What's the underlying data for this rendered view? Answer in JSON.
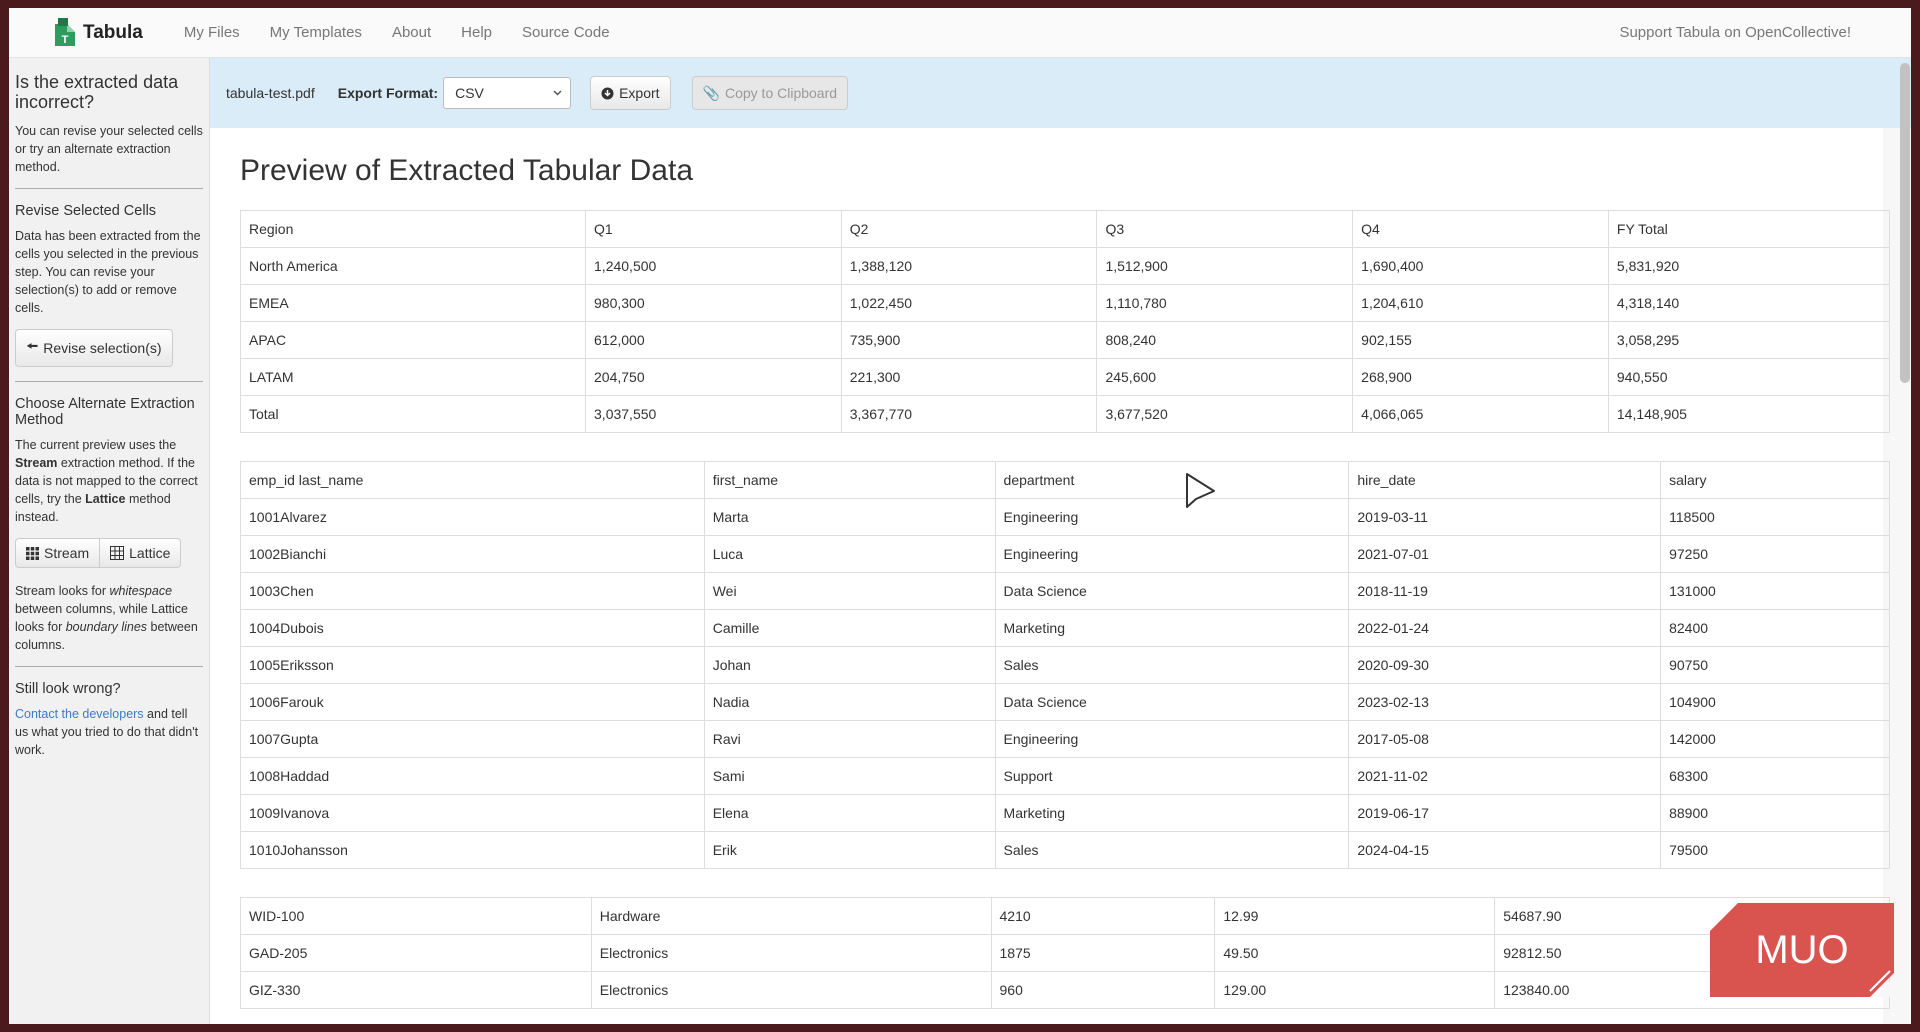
{
  "nav": {
    "brand": "Tabula",
    "links": [
      "My Files",
      "My Templates",
      "About",
      "Help",
      "Source Code"
    ],
    "support": "Support Tabula on OpenCollective!"
  },
  "sidebar": {
    "title": "Is the extracted data incorrect?",
    "intro": "You can revise your selected cells or try an alternate extraction method.",
    "revise_heading": "Revise Selected Cells",
    "revise_text": "Data has been extracted from the cells you selected in the previous step. You can revise your selection(s) to add or remove cells.",
    "revise_button": "Revise selection(s)",
    "method_heading": "Choose Alternate Extraction Method",
    "method_text_1": "The current preview uses the",
    "method_stream_bold": "Stream",
    "method_text_2": "extraction method. If the data is not mapped to the correct cells, try the",
    "method_lattice_bold": "Lattice",
    "method_text_3": "method instead.",
    "stream_button": "Stream",
    "lattice_button": "Lattice",
    "explain_1": "Stream looks for",
    "explain_whitespace": "whitespace",
    "explain_2": "between columns, while Lattice looks for",
    "explain_boundary": "boundary lines",
    "explain_3": "between columns.",
    "wrong_heading": "Still look wrong?",
    "contact_link": "Contact the developers",
    "contact_text": "and tell us what you tried to do that didn't work."
  },
  "toolbar": {
    "filename": "tabula-test.pdf",
    "format_label": "Export Format:",
    "format_value": "CSV",
    "export_button": "Export",
    "copy_button": "Copy to Clipboard"
  },
  "main": {
    "title": "Preview of Extracted Tabular Data",
    "tables": [
      {
        "col_widths": [
          340,
          252,
          252,
          252,
          252,
          277
        ],
        "rows": [
          [
            "Region",
            "Q1",
            "Q2",
            "Q3",
            "Q4",
            "FY Total"
          ],
          [
            "North America",
            "1,240,500",
            "1,388,120",
            "1,512,900",
            "1,690,400",
            "5,831,920"
          ],
          [
            "EMEA",
            "980,300",
            "1,022,450",
            "1,110,780",
            "1,204,610",
            "4,318,140"
          ],
          [
            "APAC",
            "612,000",
            "735,900",
            "808,240",
            "902,155",
            "3,058,295"
          ],
          [
            "LATAM",
            "204,750",
            "221,300",
            "245,600",
            "268,900",
            "940,550"
          ],
          [
            "Total",
            "3,037,550",
            "3,367,770",
            "3,677,520",
            "4,066,065",
            "14,148,905"
          ]
        ]
      },
      {
        "col_widths": [
          464,
          291,
          354,
          312,
          229
        ],
        "rows": [
          [
            "emp_id last_name",
            "first_name",
            "department",
            "hire_date",
            "salary"
          ],
          [
            "1001Alvarez",
            "Marta",
            "Engineering",
            "2019-03-11",
            "118500"
          ],
          [
            "1002Bianchi",
            "Luca",
            "Engineering",
            "2021-07-01",
            "97250"
          ],
          [
            "1003Chen",
            "Wei",
            "Data Science",
            "2018-11-19",
            "131000"
          ],
          [
            "1004Dubois",
            "Camille",
            "Marketing",
            "2022-01-24",
            "82400"
          ],
          [
            "1005Eriksson",
            "Johan",
            "Sales",
            "2020-09-30",
            "90750"
          ],
          [
            "1006Farouk",
            "Nadia",
            "Data Science",
            "2023-02-13",
            "104900"
          ],
          [
            "1007Gupta",
            "Ravi",
            "Engineering",
            "2017-05-08",
            "142000"
          ],
          [
            "1008Haddad",
            "Sami",
            "Support",
            "2021-11-02",
            "68300"
          ],
          [
            "1009Ivanova",
            "Elena",
            "Marketing",
            "2019-06-17",
            "88900"
          ],
          [
            "1010Johansson",
            "Erik",
            "Sales",
            "2024-04-15",
            "79500"
          ]
        ]
      },
      {
        "col_widths": [
          351,
          400,
          224,
          280,
          395
        ],
        "rows": [
          [
            "WID-100",
            "Hardware",
            "4210",
            "12.99",
            "54687.90"
          ],
          [
            "GAD-205",
            "Electronics",
            "1875",
            "49.50",
            "92812.50"
          ],
          [
            "GIZ-330",
            "Electronics",
            "960",
            "129.00",
            "123840.00"
          ]
        ]
      }
    ]
  },
  "watermark": "MUO",
  "colors": {
    "toolbar_bg": "#d9ecf7",
    "watermark": "#d9534f",
    "link": "#3a7cc8",
    "brand_icon": "#2e9c5e"
  }
}
